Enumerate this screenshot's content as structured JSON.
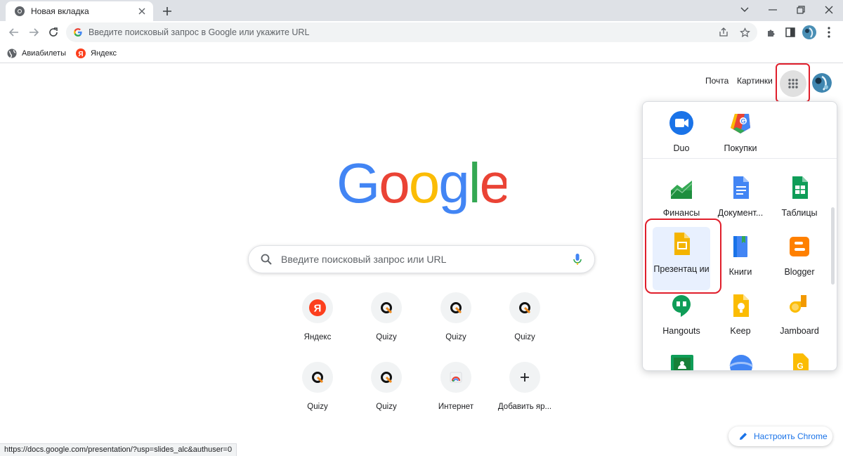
{
  "tab": {
    "title": "Новая вкладка"
  },
  "omnibox": {
    "placeholder": "Введите поисковый запрос в Google или укажите URL"
  },
  "bookmarks": [
    {
      "label": "Авиабилеты",
      "icon": "globe-icon"
    },
    {
      "label": "Яндекс",
      "icon": "yandex-icon"
    }
  ],
  "header": {
    "mail": "Почта",
    "images": "Картинки"
  },
  "search": {
    "placeholder": "Введите поисковый запрос или URL"
  },
  "shortcuts": [
    {
      "label": "Яндекс",
      "icon": "yandex-icon"
    },
    {
      "label": "Quizy",
      "icon": "quizy-icon"
    },
    {
      "label": "Quizy",
      "icon": "quizy-icon"
    },
    {
      "label": "Quizy",
      "icon": "quizy-icon"
    },
    {
      "label": "Quizy",
      "icon": "quizy-icon"
    },
    {
      "label": "Quizy",
      "icon": "quizy-icon"
    },
    {
      "label": "Интернет",
      "icon": "chrome-web-icon"
    },
    {
      "label": "Добавить яр...",
      "icon": "plus-icon"
    }
  ],
  "apps": [
    {
      "label": "Duo",
      "icon": "duo-icon"
    },
    {
      "label": "Покупки",
      "icon": "shopping-icon"
    },
    {
      "label": "Финансы",
      "icon": "finance-icon"
    },
    {
      "label": "Документ...",
      "icon": "docs-icon"
    },
    {
      "label": "Таблицы",
      "icon": "sheets-icon"
    },
    {
      "label": "Презентац ии",
      "icon": "slides-icon"
    },
    {
      "label": "Книги",
      "icon": "books-icon"
    },
    {
      "label": "Blogger",
      "icon": "blogger-icon"
    },
    {
      "label": "Hangouts",
      "icon": "hangouts-icon"
    },
    {
      "label": "Keep",
      "icon": "keep-icon"
    },
    {
      "label": "Jamboard",
      "icon": "jamboard-icon"
    }
  ],
  "customize": {
    "label": "Настроить Chrome"
  },
  "status": {
    "url": "https://docs.google.com/presentation/?usp=slides_alc&authuser=0"
  },
  "colors": {
    "highlight_border": "#e01e2b",
    "accent": "#1a73e8"
  }
}
